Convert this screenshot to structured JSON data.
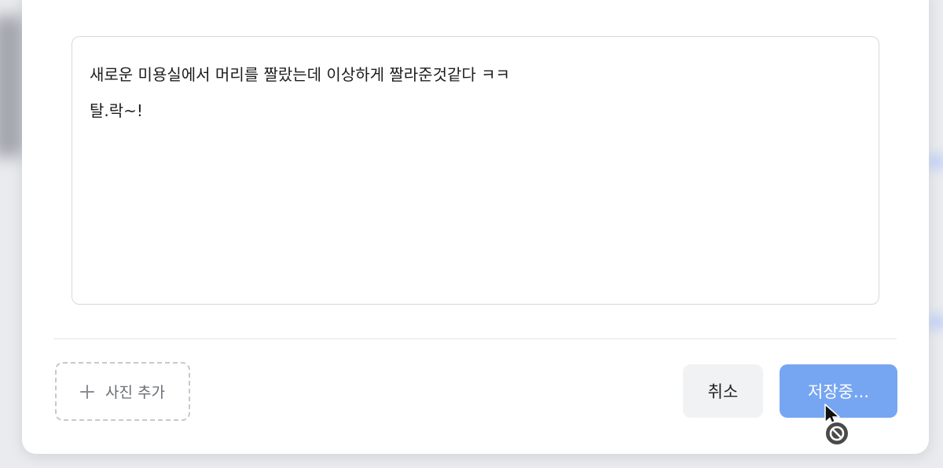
{
  "editor": {
    "lines": [
      "새로운 미용실에서 머리를 짤랐는데 이상하게 짤라준것같다 ㅋㅋ",
      "탈.락~!"
    ]
  },
  "footer": {
    "add_photo_label": "사진 추가",
    "add_photo_icon": "plus-icon",
    "cancel_label": "취소",
    "save_label": "저장중...",
    "save_color": "#76a6f1"
  },
  "cursor": {
    "icon": "pointer-cursor-icon",
    "status_icon": "not-allowed-icon"
  }
}
